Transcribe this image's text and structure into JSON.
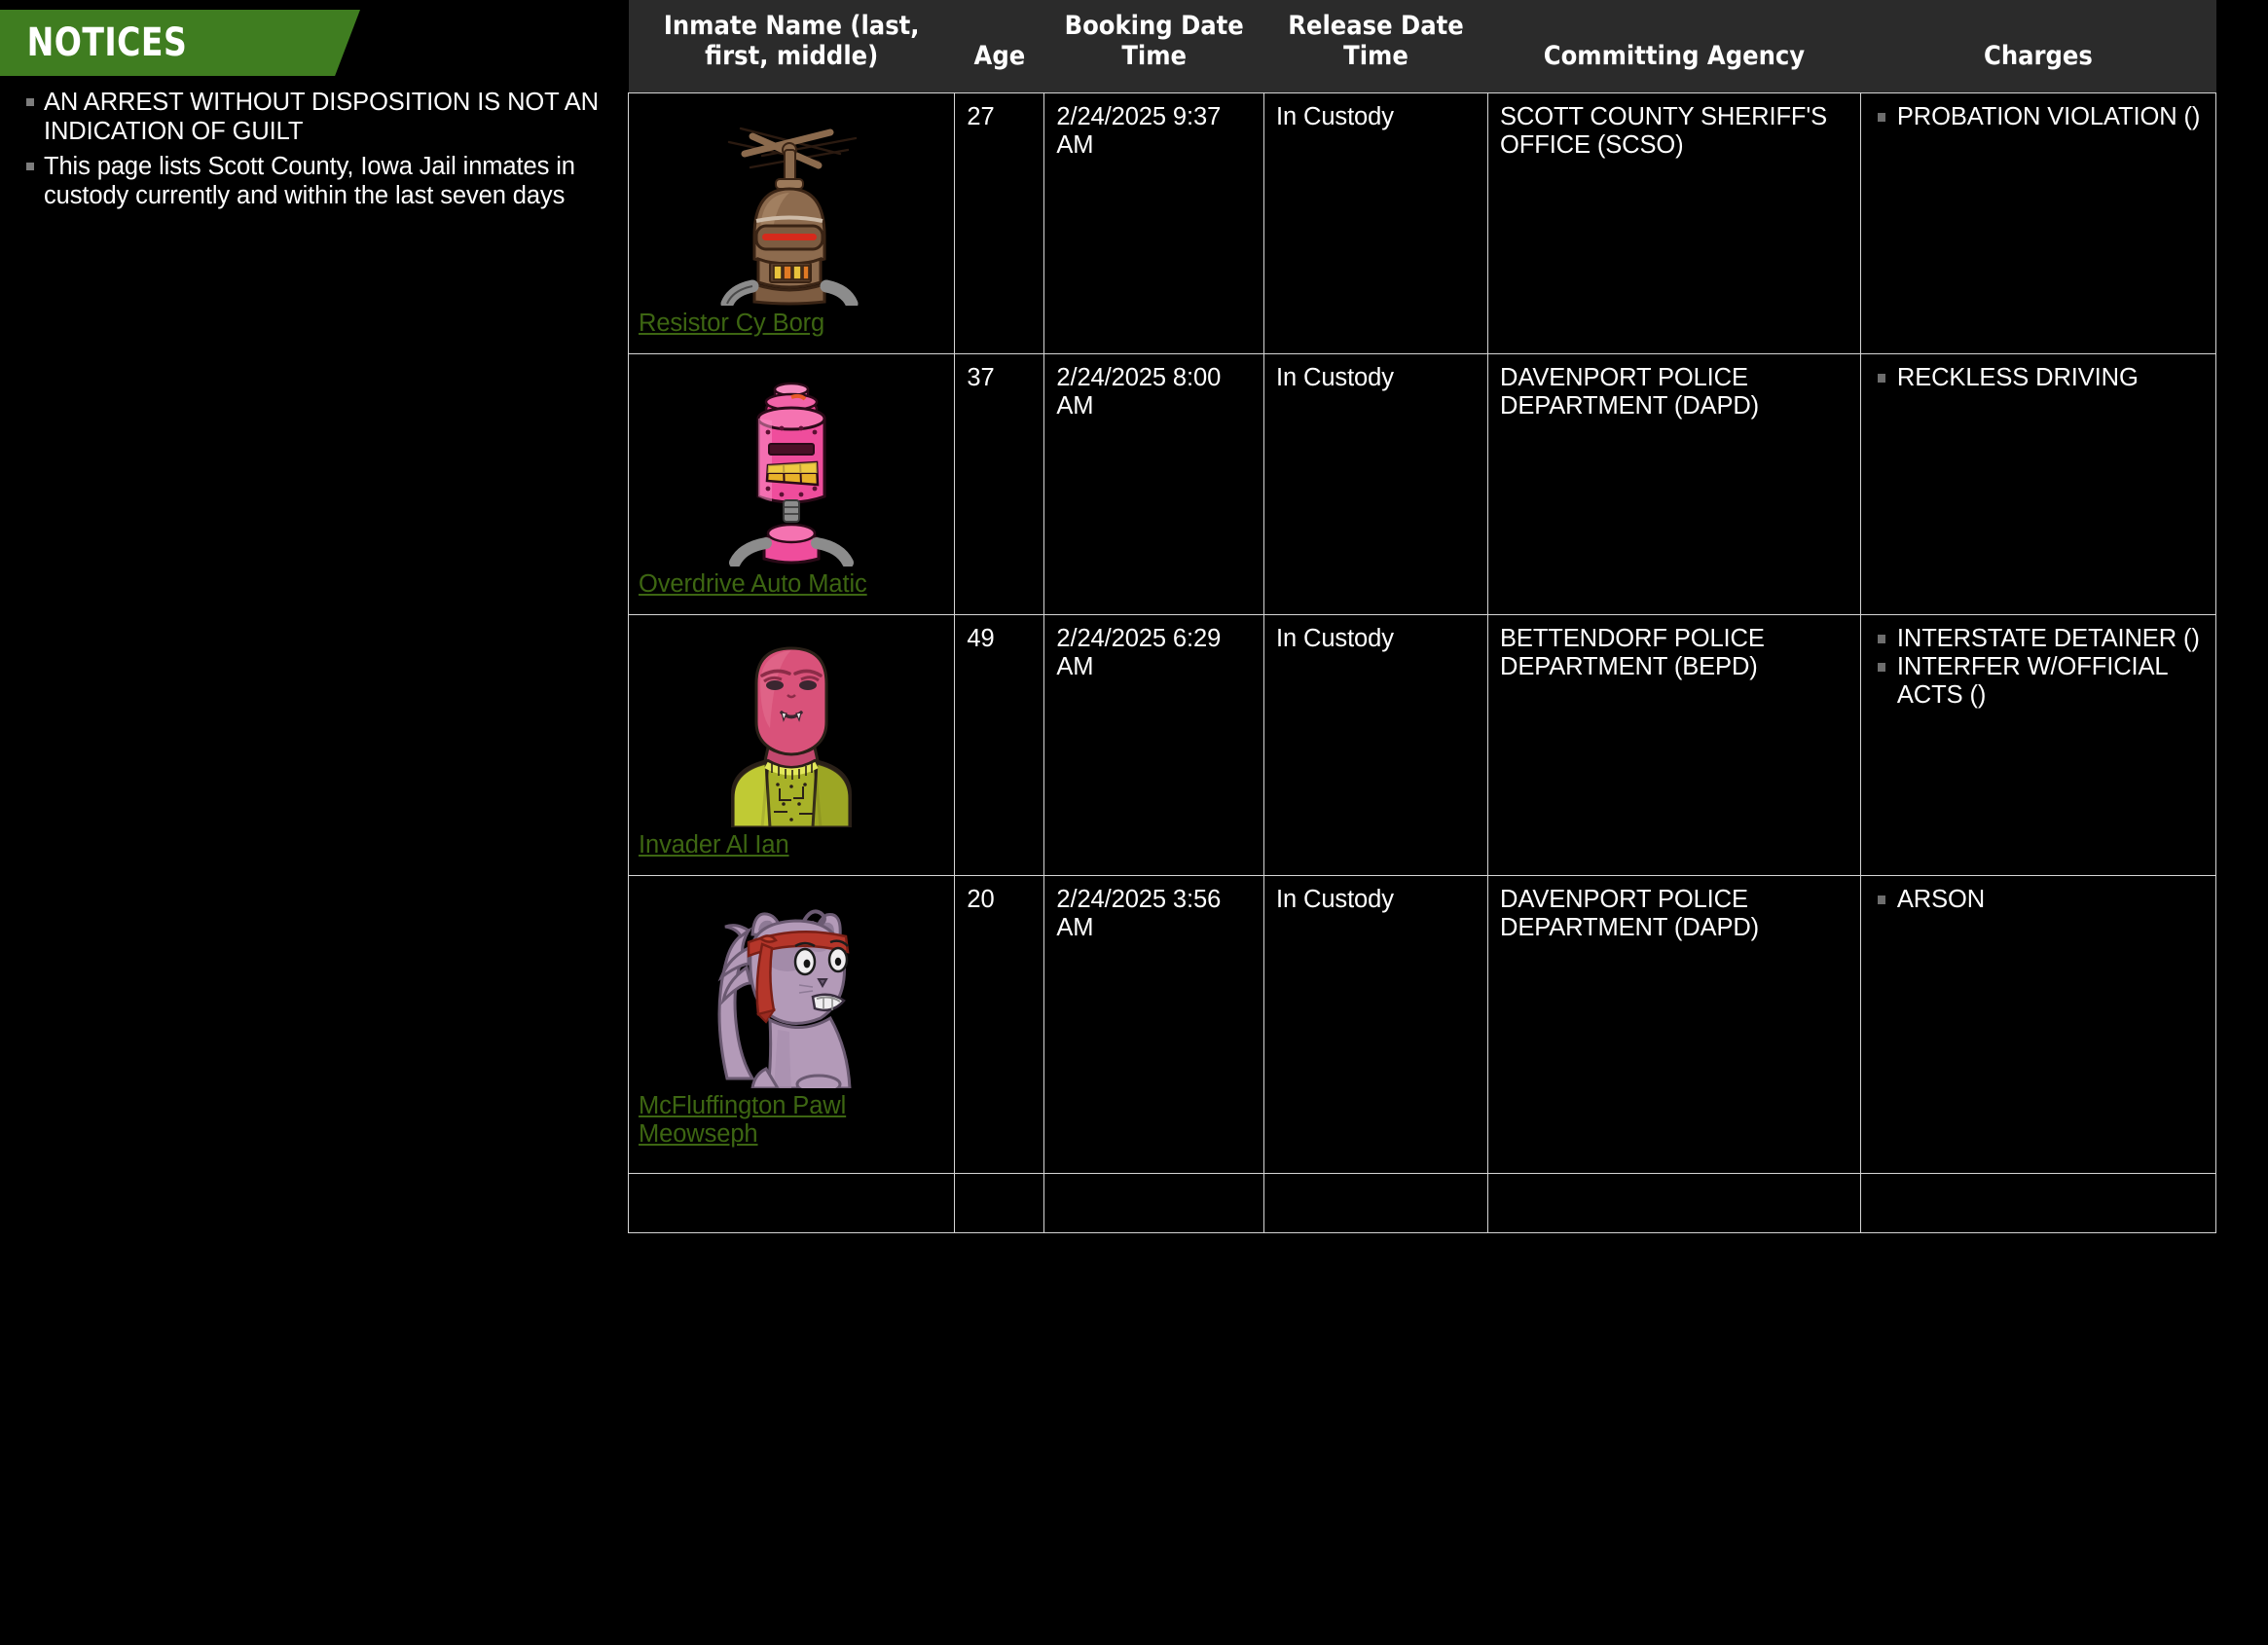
{
  "notices": {
    "title": "NOTICES",
    "banner_color": "#3f7d20",
    "items": [
      "AN ARREST WITHOUT DISPOSITION IS NOT AN INDICATION OF GUILT",
      "This page lists Scott County, Iowa Jail inmates in custody currently and within the last seven days"
    ]
  },
  "table": {
    "headers": {
      "name": "Inmate Name (last, first, middle)",
      "age": "Age",
      "booking": "Booking Date Time",
      "release": "Release Date Time",
      "agency": "Committing Agency",
      "charges": "Charges"
    },
    "header_bg": "#2b2b2b",
    "link_color": "#3d6612",
    "rows": [
      {
        "name": "Resistor Cy Borg",
        "avatar": "brown-robot-antenna-avatar",
        "age": "27",
        "booking": "2/24/2025 9:37 AM",
        "release": "In Custody",
        "agency": "SCOTT COUNTY SHERIFF'S OFFICE (SCSO)",
        "charges": [
          "PROBATION VIOLATION ()"
        ]
      },
      {
        "name": "Overdrive Auto Matic",
        "avatar": "pink-robot-avatar",
        "age": "37",
        "booking": "2/24/2025 8:00 AM",
        "release": "In Custody",
        "agency": "DAVENPORT POLICE DEPARTMENT (DAPD)",
        "charges": [
          "RECKLESS DRIVING"
        ]
      },
      {
        "name": "Invader Al Ian",
        "avatar": "pink-alien-soldier-avatar",
        "age": "49",
        "booking": "2/24/2025 6:29 AM",
        "release": "In Custody",
        "agency": "BETTENDORF POLICE DEPARTMENT (BEPD)",
        "charges": [
          "INTERSTATE DETAINER ()",
          "INTERFER W/OFFICIAL ACTS ()"
        ]
      },
      {
        "name": "McFluffington Pawl Meowseph",
        "avatar": "purple-cat-headband-avatar",
        "age": "20",
        "booking": "2/24/2025 3:56 AM",
        "release": "In Custody",
        "agency": "DAVENPORT POLICE DEPARTMENT (DAPD)",
        "charges": [
          "ARSON"
        ]
      }
    ]
  }
}
